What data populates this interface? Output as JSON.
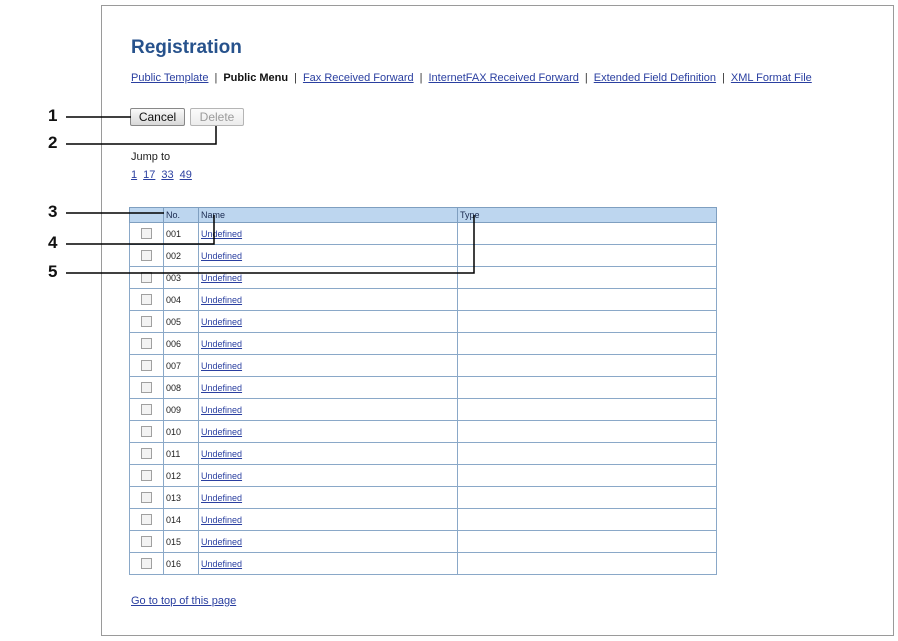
{
  "header": {
    "title": "Registration"
  },
  "tabs": [
    {
      "label": "Public Template",
      "active": false
    },
    {
      "label": "Public Menu",
      "active": true
    },
    {
      "label": "Fax Received Forward",
      "active": false
    },
    {
      "label": "InternetFAX Received Forward",
      "active": false
    },
    {
      "label": "Extended Field Definition",
      "active": false
    },
    {
      "label": "XML Format File",
      "active": false
    }
  ],
  "tab_separator": "|",
  "buttons": {
    "cancel": "Cancel",
    "delete": "Delete"
  },
  "jump": {
    "label": "Jump to",
    "links": [
      "1",
      "17",
      "33",
      "49"
    ]
  },
  "table": {
    "headers": [
      "",
      "No.",
      "Name",
      "Type"
    ],
    "rows": [
      {
        "no": "001",
        "name": "Undefined",
        "type": ""
      },
      {
        "no": "002",
        "name": "Undefined",
        "type": ""
      },
      {
        "no": "003",
        "name": "Undefined",
        "type": ""
      },
      {
        "no": "004",
        "name": "Undefined",
        "type": ""
      },
      {
        "no": "005",
        "name": "Undefined",
        "type": ""
      },
      {
        "no": "006",
        "name": "Undefined",
        "type": ""
      },
      {
        "no": "007",
        "name": "Undefined",
        "type": ""
      },
      {
        "no": "008",
        "name": "Undefined",
        "type": ""
      },
      {
        "no": "009",
        "name": "Undefined",
        "type": ""
      },
      {
        "no": "010",
        "name": "Undefined",
        "type": ""
      },
      {
        "no": "011",
        "name": "Undefined",
        "type": ""
      },
      {
        "no": "012",
        "name": "Undefined",
        "type": ""
      },
      {
        "no": "013",
        "name": "Undefined",
        "type": ""
      },
      {
        "no": "014",
        "name": "Undefined",
        "type": ""
      },
      {
        "no": "015",
        "name": "Undefined",
        "type": ""
      },
      {
        "no": "016",
        "name": "Undefined",
        "type": ""
      }
    ]
  },
  "footer": {
    "goto_top": "Go to top of this page"
  },
  "callouts": [
    "1",
    "2",
    "3",
    "4",
    "5"
  ],
  "colors": {
    "title": "#27528c",
    "link": "#2a3fa0",
    "header_bg": "#bdd6ef",
    "grid_border": "#8aa8c8"
  }
}
